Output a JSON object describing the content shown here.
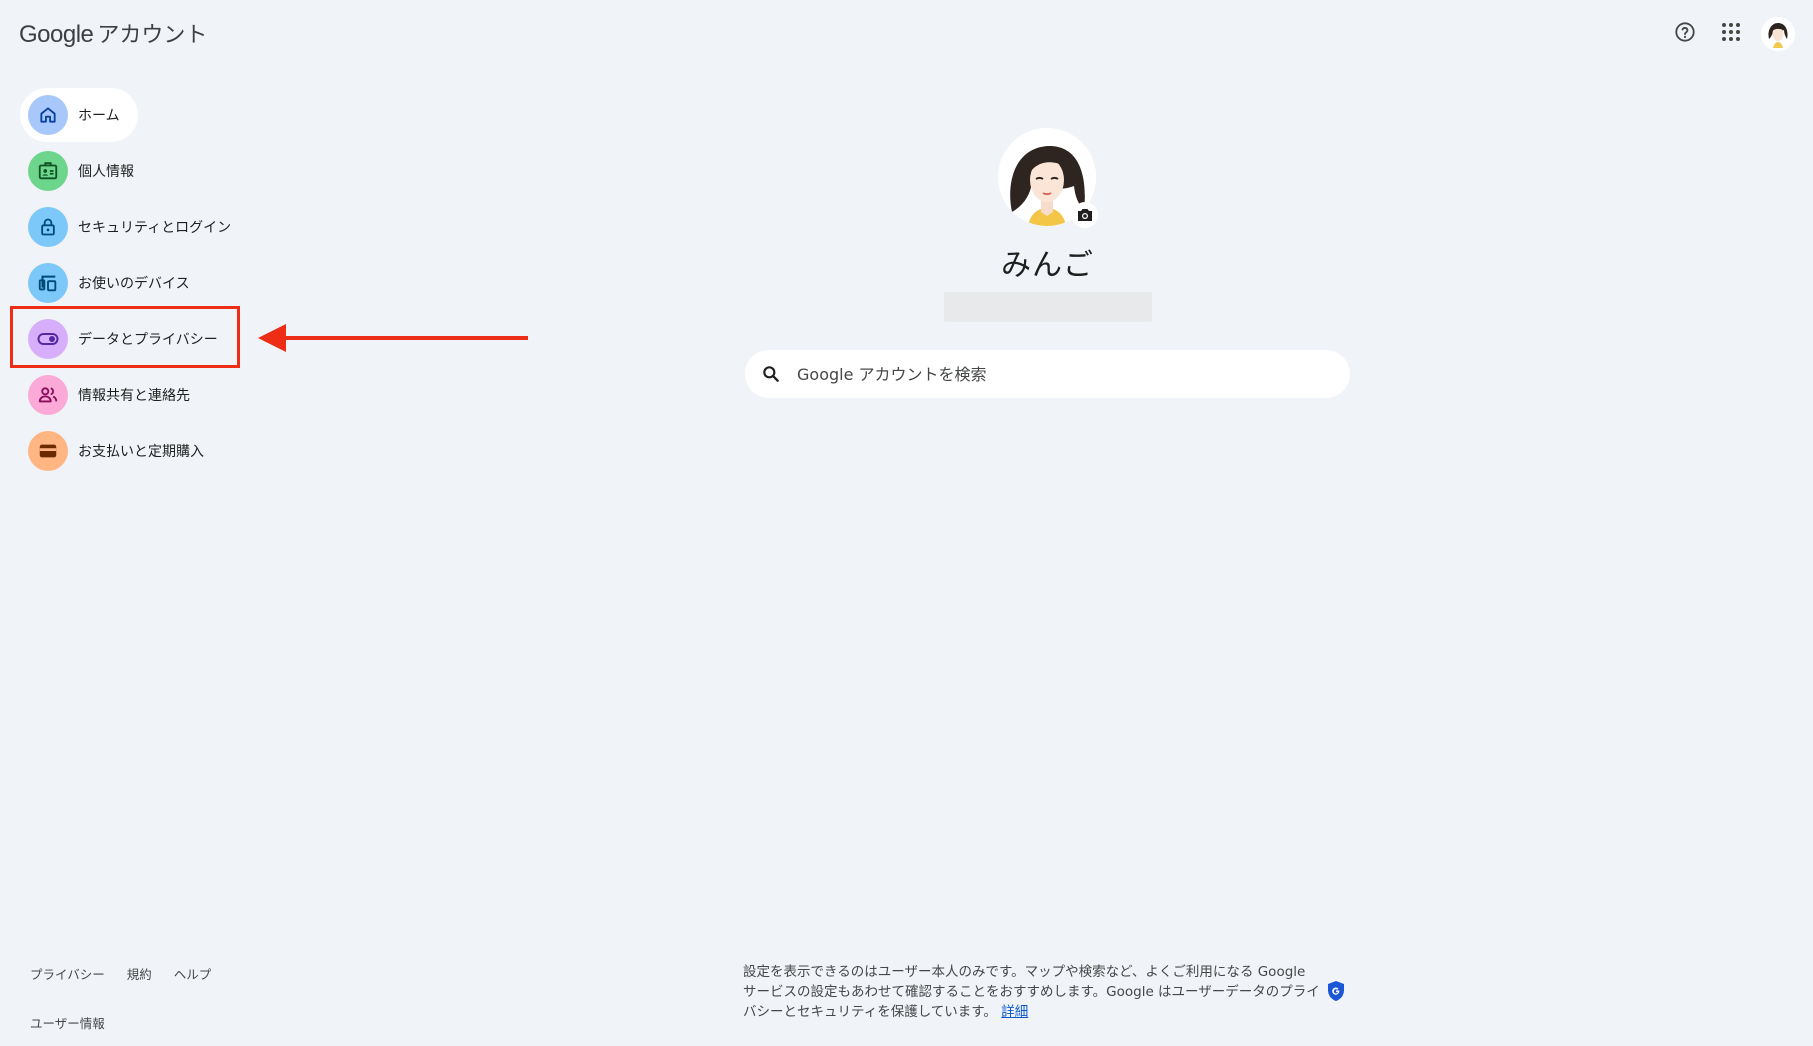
{
  "header": {
    "brand_google": "Google",
    "brand_product": "アカウント"
  },
  "nav": {
    "items": [
      {
        "label": "ホーム",
        "icon": "home-icon",
        "color": "#a8c7fa"
      },
      {
        "label": "個人情報",
        "icon": "id-card-icon",
        "color": "#6dd58c"
      },
      {
        "label": "セキュリティとログイン",
        "icon": "lock-icon",
        "color": "#7cc8f8"
      },
      {
        "label": "お使いのデバイス",
        "icon": "devices-icon",
        "color": "#7cc8f8"
      },
      {
        "label": "データとプライバシー",
        "icon": "toggle-icon",
        "color": "#d7aefb"
      },
      {
        "label": "情報共有と連絡先",
        "icon": "people-icon",
        "color": "#fba9d6"
      },
      {
        "label": "お支払いと定期購入",
        "icon": "wallet-icon",
        "color": "#ffb683"
      }
    ]
  },
  "profile": {
    "name": "みんご"
  },
  "search": {
    "placeholder": "Google アカウントを検索"
  },
  "footer": {
    "links": [
      "プライバシー",
      "規約",
      "ヘルプ"
    ],
    "user_info": "ユーザー情報",
    "privacy_note": "設定を表示できるのはユーザー本人のみです。マップや検索など、よくご利用になる Google サービスの設定もあわせて確認することをおすすめします。Google はユーザーデータのプライバシーとセキュリティを保護しています。",
    "learn_more": "詳細"
  },
  "colors": {
    "background": "#f0f4f9",
    "annotation": "#ee2d17",
    "link": "#0b57d0"
  }
}
